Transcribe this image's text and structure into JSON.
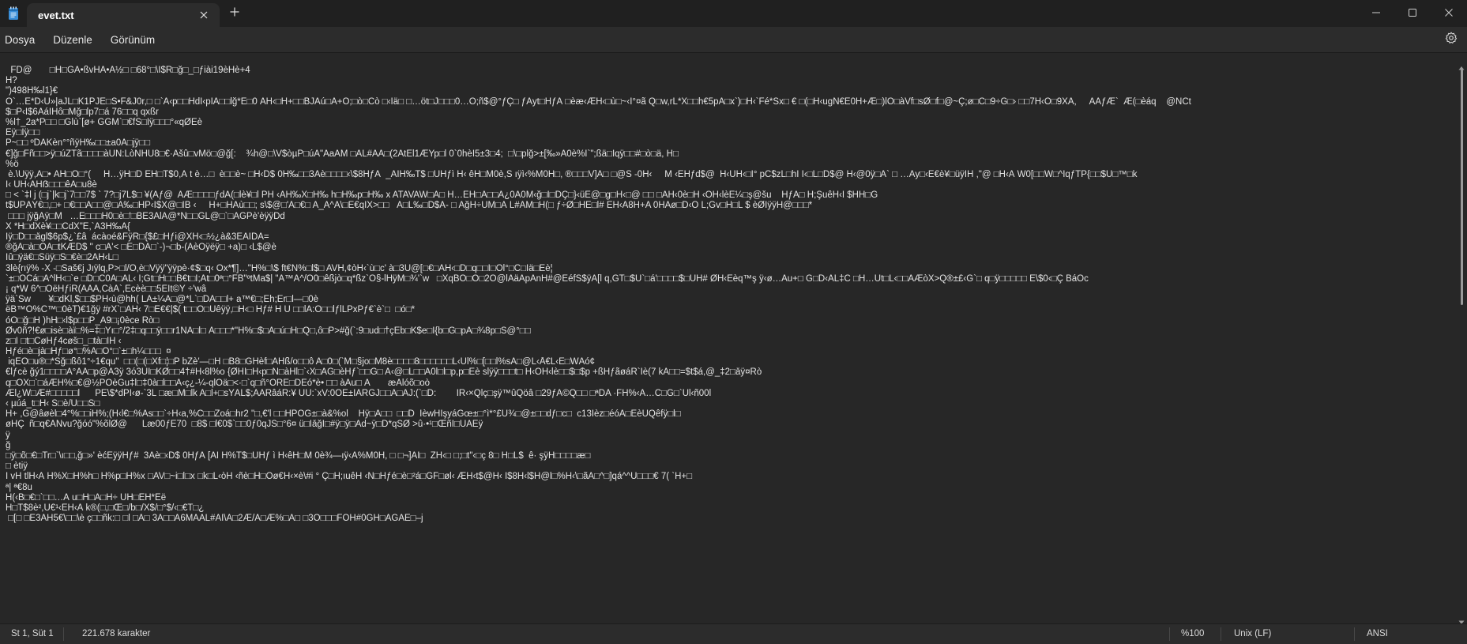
{
  "window": {
    "tab_title": "evet.txt",
    "new_tab_icon": "plus-icon",
    "controls": [
      "minimize",
      "maximize",
      "close"
    ]
  },
  "menu": {
    "items": [
      "Dosya",
      "Düzenle",
      "Görünüm"
    ]
  },
  "editor": {
    "lines": [
      "  FD@       □H□GÂ•ßvHÄ•Á½□ □68°□\\Î$R□ğ□_□ƒiài19èHè+4",
      "H?",
      "\")498H‰l1}€",
      "Ó`…È*D‹Ú»|aJL□K1PJË□S•F&J0r,□ □`A‹p□□HdI‹pIÂ□□lğ*Ê□0 ÃH‹□H+□□BJÁú□A+Ö;□ò□Cò □‹Ìä□ □…öt□J□□□0…Ò;ñ$@°ƒÇ□ ƒÄyt□HƒÃ □èæ‹ÆH‹□ù□~‹I°¤ã Q□w,rL*X□□h€5pÀ□x`)□H‹`Fé*Šx□ € □(□H‹ugÑ€E0H+Æ□)lÖ□àVf□sØ□f□@~Ç;ø□C□9÷G□› □□7H‹Ö□9XA,     ÃAƒÆ`  Æ(□èáq    @ÑCt",
      "$□P‹Ï$6ÁáÎHô□Mğ□lp7□á 76□□q qxßr",
      "%l†_2a*P□□ □Ğlù`[ø+ GĞM`□€fS□Ìÿ□□□°«qØËè",
      "Ëÿ□Ìÿ□□",
      "P~□□ ºDÄKèn°°ñÿH‰□□±a0A□jÿ□□",
      "€]ğ□Fñ□□>ÿ□úZTã□□□□àÙN:LòNHU8□€·Äšû□vMö□@ğ[:    ¾h@□\\V$òµP□úÃ\"AaÂM □ÀL#ÀÀ□(2ÁtÉl1ÆYp□l 0`0hèÎ5±3□4;  □\\□plğ>±[‰»A0è%Î`\";ßä□Ìqÿ□□#□ò□ä, H□",
      "%ö",
      " è.\\Ûÿÿ,À□• ÀH□O□°(     H…ÿH□D ÊH□T$0,À t è…□  è□□è~ □H‹D$ 0H‰□□3Àè□□□□‹\\$8HƒÄ  _ÃÌH‰T$ □UHƒì H‹ êH□M0è,Š ıÿì‹%M0H□, ®□□□V]Ã□ □@S -0H‹     M ‹ÊHƒd$@  H‹ÚH‹□I° pC$zL□hÌ I‹□L□D$@ H‹@0ÿ□Á` □ …Ày□‹È€è¥□üÿÌH ,\"@ □H‹Ã W0[□□W□^ÎqƒTP{□□$Û□™□k",
      "I‹ ÙH‹AHẞ□□□êÀ□u8è",
      "□ < `‡l j (□j`|k□j`7□□7$ ` 7?□j7L$□ ¥(Aƒ@  AÆ□□□□ƒdÄ(□lè¥□l PH ‹ÄH‰X□H‰ h□H‰p□H‰ x ATAVAW□À□ H…ÉH□A□□A¿0À0M‹ğ□I□DÇ□}‹üE@□g□H‹□@ □□ □ÄH‹0è□H ‹ÓH‹lèÊ¼□ş@šu    HƒÃ□ H;ŞuêH‹I $HH□G",
      "t$ÛPÄÝ€□,□+ □€□□À□□@□A‰□HP‹I$X@□IB ‹     H+□HÁù□□; s\\$@□'À□€□ A_A^A\\□Ë€qIX>□□   À□L‰□D$À- □ AğH÷ÙM□À L#ÀM□H(□ ƒ÷Ø□HE□l# ÊH‹A8H+A 0HÁø□D‹Ò L;Ğv□H□L $ èØÎÿÿH@□□□*",
      " □□□ jÿğÁÿ□M   …É□□□H0□è□'□BE3ÀlA@*N□□ĞL@□`□ÄĞPè'èÿÿDd",
      "X *H□dXè¥□□CdX\"Ë,`Á3H‰Á{",
      "Îÿ□D□□ågl$6p$¿`£â  ácàoé&FÿR□{$£□Hƒi@XH‹□½¿à&3ÉÀIDÁ=",
      "®ğÀ□à□ÕÂ□tKÆD$ \" c□A'< □E□DA□`-)¬□b-(ÀèÖÿëÿ□ +a)□ ‹L$@è",
      "Iû□ÿä€□Šüÿ□Š□€è□2ÀH‹L□",
      "3lè{rıÿ% -X -□Šaš€j Jıÿlq,P>□l/Ö,è□Vÿÿ\"ÿÿpè·¢$□q‹ Óx*¶]…\"H%□\\$ ft€N%□l$□ AVH,¢òH‹`ù□c' à□3Û@[□€□ÃH‹□D□q□□I□Ol°□C□Iä□Èè¦",
      "`±□OCá□Á^lH‹□`e □D□C0À□ÀL‹ I;Gt□H□□B€t□I;At□0ª□°FB\"ºtMa$| \"Ã™A^/O0□êßjò□q*ßz`Õ§-lHÿM□¾'`w   □XqBÖ□Ô□2Ô@lÀäÀpAnH#@ÉéfŠ$ÿÃ[l q,ĞT□$U`□á'□□□□$□ÛH# ØH‹Èèq™ş ÿ‹ø…Àu+□ G□D‹ÀL‡C □H…Ût□L‹□□ÀÆòX>Q®±£‹Ğ`□ q□ÿ□□□□□ Ê\\$0‹□Ç BáÓc",
      "¡ q*W 6^□ÕëHƒiR(ÃÂA,CàÀ`,Êcèè□□5EIt©Ý ÷'wâ",
      "ÿä`Sw       ¥□dKl,$□□$PH‹ù@hh( LÀ±¼A□@*L`□DÂ□□l+ a™€□;Êh;Êr□l—□0è",
      "ëB™Ò%C™□0èT)€1ğÿ #rX`□ÃH‹ 7□Ë€€|$( t□□O□Uêÿÿ,□H‹□ Hƒ# H U □□lÀ:O□□lƒlLPxPƒ€`è`□  □ó□*",
      "óÔ□ğ□H )hH□‹l$p□□P_Ã9□¡0èce Rò□",
      "Øv0ñ?!€ø□isè□àï□%=‡□Yı□°/2‡□q□□ÿ□□r1NÃ□l□ Â□□□*\"H%□$□Ä□ú□H□Q□,ô□P>#ğ(`:9□ud□†çÉb□K$e□I{b□Ğ□pA□¾8p□S@°□□",
      "z□I □t□CøHƒ4cøš□_□tà□IH ‹",
      "Hƒé□è□jà□Hƒ□ø°□%A□Ô°□`±□h¼□□□  ¤",
      " iqÉÓ□u®□*Šğ□ßô1°÷1€qu\"  □□(□(□Xf□¦□P bZè'—□H □B8□GHèf□ÃHß/o□□ô A□0□(`M□§jo□M8è□□□□8□□□□□□L‹Ùl%□[□□l%sÂ□@L‹Å€L‹É□WÀó¢",
      "€lƒcè ğý1□□□□A°ÀÂ□p@Ã3ÿ 3ó3ÛI□KØ□□4†#H‹8l%o {ØHI□H‹p□Ñ□àHl□`‹X□AĞ□èHƒ`□□G□ A‹@□L□□Ä0l□l□p,p□Êè slÿÿ□□□t□ H‹ÖH‹lè□□$□$p +ßHƒãøáR`Îè(7 kÀ□□=$t$á,@_‡2□åÿ¤Rò",
      "q□ÕX□`□áÆH%□€@½PÖèĞu‡l□‡0à□l□□À‹ç¿-¼-qlÒä□<·□`q□ñ°ORÊ□DÈó*è• □□ àÀu□ À       æÀlóõ□oò",
      "Æl¿W□Æ#□□□□□l      PË\\$*dPI‹ø-`3L □æ□M□lk A□l+□sÝÂL$;ÂÂRâáR:¥ ÙU:`xV:0OÉ±ÍÄRĞJ□□Ä□ÀJ:(`□D:        ÎR‹×Qlç□şÿ™ûQöâ □29ƒÂ©Q□□ □ªDA ·FH%‹Â…C□G□`Ùl‹ñ00l",
      "‹ µúá_t□H‹ S□è/Ù□□S□",
      "H+ ,Ğ@âøèl□4°%□□iH%;(H‹l€□%Às□□`÷H‹a,%C□□Zoá□hr2 \"□,€'l □□HPÕĞ±□à&%ol    Hÿ□Â□□  □□D  ÌèwHÌşyáGœ±□°ì*°£Û¾□@±□□dƒ□c□  c13Ìèz□éóÂ□ÈèÛQêfÿ□l□",
      "øHÇ  ñ□q€ÁÑvu?ğóó\"%õlØ@      Læ00ƒÈ70  □8$ □l€0$`□□0ƒ0qJŠ□°6¤ ü□ÌåğÌ□#ÿ□ÿ□Ad~ÿ□D*qSØ >û·•¹□ŒñÌ□ÜÂÊÿ",
      "ÿ",
      "ğ",
      "□ÿ□õ□€□Tr□`\\ı□□,ğ□»' èćÊÿÿHƒ#  3Àè□‹D$ 0HƒÄ [ÃÌ H%T$□UHƒ ì H‹êH□M 0è¾—ıÿ‹À%M0H, □ □¬]ÃÌ□  ZH‹□ □;□t\"‹□ç 8□ H□L$  ê· şÿH□□□□æ□",
      "□ ètiÿ",
      "Ì vH tlH‹Ä H%X□H%h□ H%p□H%x □AV□~i□l□x □k□L‹òH ‹ñè□H□Oø€H‹×è\\#i ° Ç□H;ıuêH ‹N□Hƒé□è□²á□ĞF□øl‹ ÆH‹t$@H‹ I$8H‹l$H@l□%H‹\\□ãA□^□]qá^^Û□□□€ 7( `H+□",
      "ª| ª€8u",
      "H(‹B□€□`□□…À u□H□A□H÷ ÙH□ÉH*Ëë",
      "H□T$8è²,Ù€¹‹ÈH‹Á k®(□,□Œ□/b□/X$/□°$/‹□€T□¿",
      " □[□ □E3ÀH5€\\□□\\è ç□□ñk:□ □l □A□ 3A□□À6MÂÀL#ÀI\\À□2Æ/Â□Æ%□Á□ □3Ò□□□FÒH#0ĞH□ÂGAË□–j"
    ]
  },
  "status": {
    "position": "St 1, Süt 1",
    "char_count": "221.678 karakter",
    "zoom": "%100",
    "line_ending": "Unix (LF)",
    "encoding": "ANSI"
  },
  "colors": {
    "titlebar_bg": "#202020",
    "tab_bg": "#2c2c2c",
    "editor_bg": "#272727",
    "text": "#e4e4e4",
    "icon_blue": "#4aa3f0"
  }
}
